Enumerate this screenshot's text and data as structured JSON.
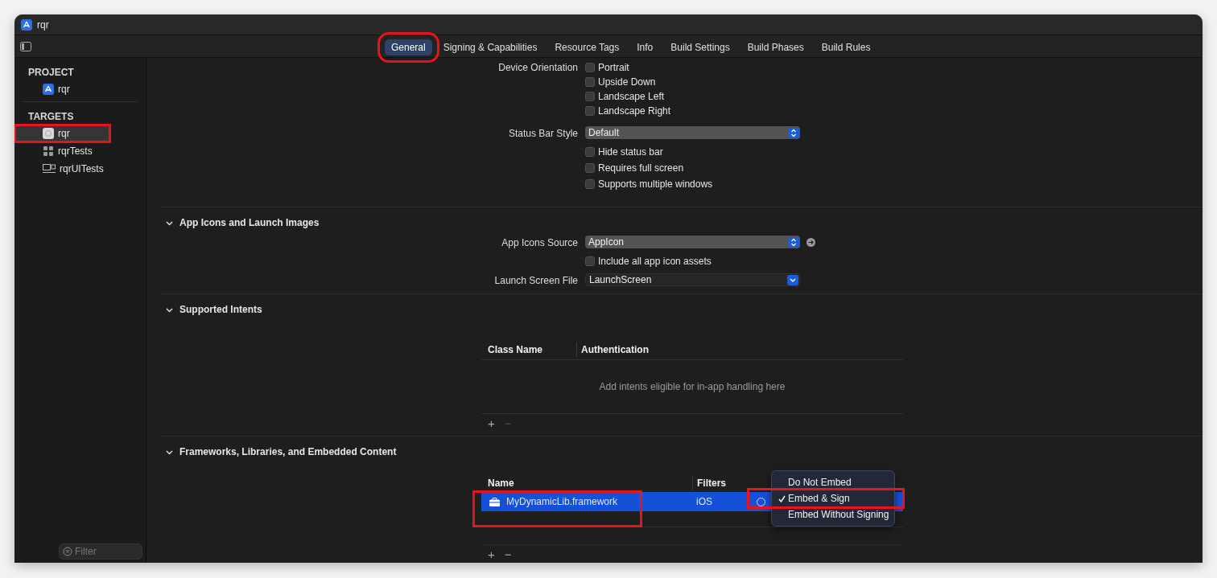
{
  "window": {
    "title": "rqr"
  },
  "tabs": [
    {
      "label": "General",
      "selected": true,
      "annotated": true
    },
    {
      "label": "Signing & Capabilities",
      "selected": false,
      "annotated": false
    },
    {
      "label": "Resource Tags",
      "selected": false,
      "annotated": false
    },
    {
      "label": "Info",
      "selected": false,
      "annotated": false
    },
    {
      "label": "Build Settings",
      "selected": false,
      "annotated": false
    },
    {
      "label": "Build Phases",
      "selected": false,
      "annotated": false
    },
    {
      "label": "Build Rules",
      "selected": false,
      "annotated": false
    }
  ],
  "sidebar": {
    "sections": [
      {
        "heading": "PROJECT",
        "items": [
          {
            "label": "rqr",
            "kind": "project",
            "selected": false,
            "annotated": false
          }
        ]
      },
      {
        "heading": "TARGETS",
        "items": [
          {
            "label": "rqr",
            "kind": "app",
            "selected": true,
            "annotated": true
          },
          {
            "label": "rqrTests",
            "kind": "tests",
            "selected": false,
            "annotated": false
          },
          {
            "label": "rqrUITests",
            "kind": "uitests",
            "selected": false,
            "annotated": false
          }
        ]
      }
    ],
    "filter": {
      "placeholder": "Filter"
    }
  },
  "top_rows": [
    {
      "kind": "checks",
      "label": "Device Orientation",
      "options": [
        {
          "label": "Portrait",
          "checked": false
        },
        {
          "label": "Upside Down",
          "checked": false
        },
        {
          "label": "Landscape Left",
          "checked": false
        },
        {
          "label": "Landscape Right",
          "checked": false
        }
      ]
    },
    {
      "kind": "select",
      "label": "Status Bar Style",
      "value": "Default"
    },
    {
      "kind": "checks",
      "options": [
        {
          "label": "Hide status bar",
          "checked": false
        },
        {
          "label": "Requires full screen",
          "checked": false
        },
        {
          "label": "Supports multiple windows",
          "checked": false
        }
      ]
    }
  ],
  "sections": [
    {
      "title": "App Icons and Launch Images",
      "expanded": true,
      "rows": [
        {
          "kind": "select",
          "label": "App Icons Source",
          "value": "AppIcon",
          "link": true
        },
        {
          "kind": "checks",
          "options": [
            {
              "label": "Include all app icon assets",
              "checked": false
            }
          ]
        },
        {
          "kind": "combo",
          "label": "Launch Screen File",
          "value": "LaunchScreen"
        }
      ]
    },
    {
      "title": "Supported Intents",
      "expanded": true,
      "table": {
        "columns": [
          "Class Name",
          "Authentication"
        ],
        "empty_text": "Add intents eligible for in-app handling here",
        "buttons": [
          {
            "label": "+",
            "disabled": false
          },
          {
            "label": "−",
            "disabled": true
          }
        ]
      }
    },
    {
      "title": "Frameworks, Libraries, and Embedded Content",
      "expanded": true,
      "table": {
        "columns": [
          "Name",
          "Filters"
        ],
        "rows": [
          {
            "name": "MyDynamicLib.framework",
            "filters": "iOS",
            "selected": true,
            "annotated": true
          }
        ],
        "buttons": [
          {
            "label": "+",
            "disabled": false
          },
          {
            "label": "−",
            "disabled": false
          }
        ],
        "menu": {
          "items": [
            {
              "label": "Do Not Embed",
              "selected": false,
              "annotated": false
            },
            {
              "label": "Embed & Sign",
              "selected": true,
              "annotated": true
            },
            {
              "label": "Embed Without Signing",
              "selected": false,
              "annotated": false
            }
          ]
        }
      }
    }
  ]
}
